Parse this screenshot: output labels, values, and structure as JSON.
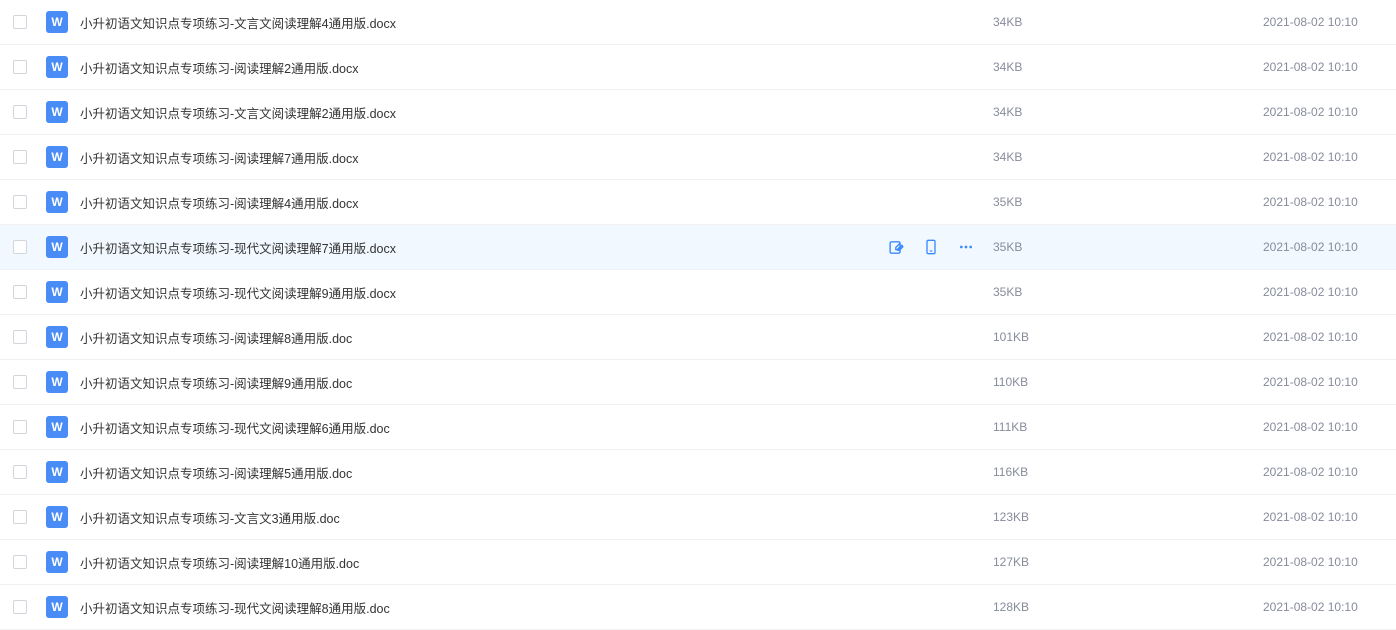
{
  "icon_letter": "W",
  "hovered_index": 5,
  "files": [
    {
      "name": "小升初语文知识点专项练习-文言文阅读理解4通用版.docx",
      "size": "34KB",
      "time": "2021-08-02 10:10"
    },
    {
      "name": "小升初语文知识点专项练习-阅读理解2通用版.docx",
      "size": "34KB",
      "time": "2021-08-02 10:10"
    },
    {
      "name": "小升初语文知识点专项练习-文言文阅读理解2通用版.docx",
      "size": "34KB",
      "time": "2021-08-02 10:10"
    },
    {
      "name": "小升初语文知识点专项练习-阅读理解7通用版.docx",
      "size": "34KB",
      "time": "2021-08-02 10:10"
    },
    {
      "name": "小升初语文知识点专项练习-阅读理解4通用版.docx",
      "size": "35KB",
      "time": "2021-08-02 10:10"
    },
    {
      "name": "小升初语文知识点专项练习-现代文阅读理解7通用版.docx",
      "size": "35KB",
      "time": "2021-08-02 10:10"
    },
    {
      "name": "小升初语文知识点专项练习-现代文阅读理解9通用版.docx",
      "size": "35KB",
      "time": "2021-08-02 10:10"
    },
    {
      "name": "小升初语文知识点专项练习-阅读理解8通用版.doc",
      "size": "101KB",
      "time": "2021-08-02 10:10"
    },
    {
      "name": "小升初语文知识点专项练习-阅读理解9通用版.doc",
      "size": "110KB",
      "time": "2021-08-02 10:10"
    },
    {
      "name": "小升初语文知识点专项练习-现代文阅读理解6通用版.doc",
      "size": "111KB",
      "time": "2021-08-02 10:10"
    },
    {
      "name": "小升初语文知识点专项练习-阅读理解5通用版.doc",
      "size": "116KB",
      "time": "2021-08-02 10:10"
    },
    {
      "name": "小升初语文知识点专项练习-文言文3通用版.doc",
      "size": "123KB",
      "time": "2021-08-02 10:10"
    },
    {
      "name": "小升初语文知识点专项练习-阅读理解10通用版.doc",
      "size": "127KB",
      "time": "2021-08-02 10:10"
    },
    {
      "name": "小升初语文知识点专项练习-现代文阅读理解8通用版.doc",
      "size": "128KB",
      "time": "2021-08-02 10:10"
    }
  ]
}
